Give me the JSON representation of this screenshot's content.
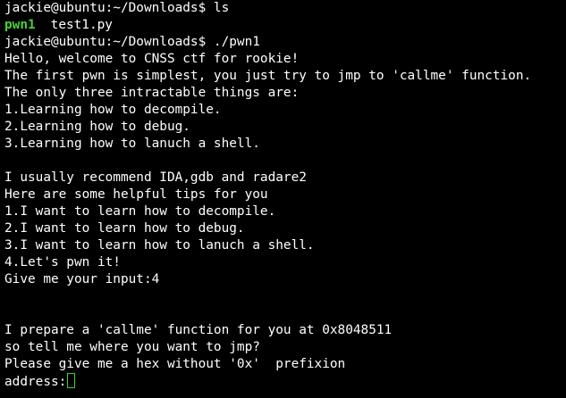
{
  "terminal": {
    "lines": [
      "jackie@ubuntu:~/Downloads$ ls",
      "",
      "jackie@ubuntu:~/Downloads$ ./pwn1",
      "Hello, welcome to CNSS ctf for rookie!",
      "The first pwn is simplest, you just try to jmp to 'callme' function.",
      "The only three intractable things are:",
      "1.Learning how to decompile.",
      "2.Learning how to debug.",
      "3.Learning how to lanuch a shell.",
      "",
      "I usually recommend IDA,gdb and radare2",
      "Here are some helpful tips for you",
      "1.I want to learn how to decompile.",
      "2.I want to learn how to debug.",
      "3.I want to learn how to lanuch a shell.",
      "4.Let's pwn it!",
      "Give me your input:4",
      "",
      "",
      "I prepare a 'callme' function for you at 0x8048511",
      "so tell me where you want to jmp?",
      "Please give me a hex without '0x'  prefixion",
      "address:"
    ],
    "ls_output": {
      "executable": "pwn1",
      "file": "test1.py"
    },
    "colors": {
      "background": "#000000",
      "text": "#ffffff",
      "executable": "#4cd137",
      "cursor": "#32d232"
    }
  }
}
